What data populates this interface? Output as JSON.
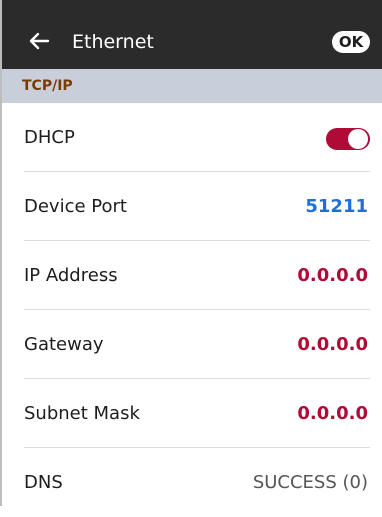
{
  "header": {
    "title": "Ethernet",
    "ok_label": "OK"
  },
  "section": {
    "title": "TCP/IP"
  },
  "settings": [
    {
      "label": "DHCP",
      "toggle_on": true
    },
    {
      "label": "Device Port",
      "value": "51211"
    },
    {
      "label": "IP Address",
      "value": "0.0.0.0"
    },
    {
      "label": "Gateway",
      "value": "0.0.0.0"
    },
    {
      "label": "Subnet Mask",
      "value": "0.0.0.0"
    },
    {
      "label": "DNS",
      "value": "SUCCESS (0)"
    }
  ],
  "icons": {
    "back": "arrow-left-icon"
  },
  "colors": {
    "header_bg": "#2b2b2b",
    "section_bg": "#c8cfdb",
    "section_text": "#7a3a00",
    "accent_red": "#b00a36",
    "accent_blue": "#1e6fd9"
  }
}
